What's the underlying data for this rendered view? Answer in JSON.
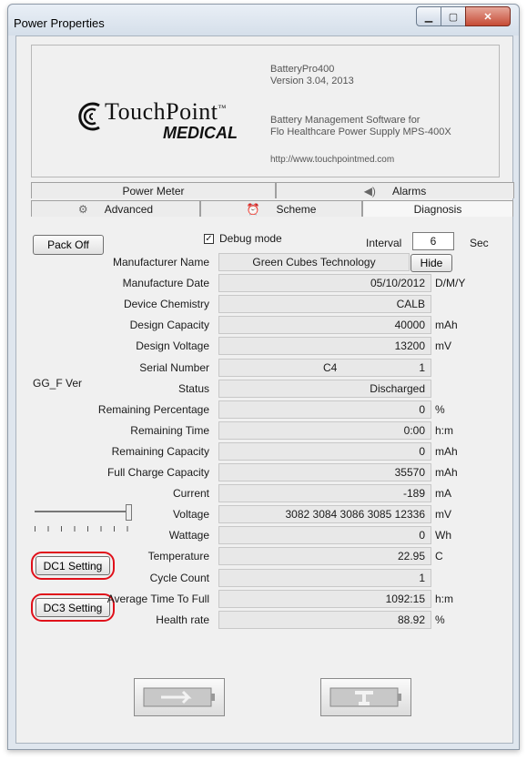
{
  "window": {
    "title": "Power Properties"
  },
  "about": {
    "product": "BatteryPro400",
    "version": "Version  3.04, 2013",
    "desc1": "Battery Management Software for",
    "desc2": "Flo Healthcare Power Supply MPS-400X",
    "url": "http://www.touchpointmed.com",
    "logo_top": "TouchPoint",
    "logo_tm": "™",
    "logo_bottom": "MEDICAL"
  },
  "tabs": {
    "row1": [
      {
        "label": "Power Meter"
      },
      {
        "label": "Alarms"
      }
    ],
    "row2": [
      {
        "label": "Advanced"
      },
      {
        "label": "Scheme"
      },
      {
        "label": "Diagnosis"
      }
    ]
  },
  "controls": {
    "pack_off": "Pack Off",
    "debug_label": "Debug mode",
    "debug_checked": true,
    "interval_label": "Interval",
    "interval_value": "6",
    "interval_unit": "Sec",
    "hide": "Hide",
    "gg_f_ver": "GG_F Ver",
    "dc1": "DC1 Setting",
    "dc3": "DC3 Setting"
  },
  "rows": [
    {
      "label": "Manufacturer Name",
      "value": "Green Cubes Technology",
      "unit": ""
    },
    {
      "label": "Manufacture Date",
      "value": "05/10/2012",
      "unit": "D/M/Y"
    },
    {
      "label": "Device Chemistry",
      "value": "CALB",
      "unit": ""
    },
    {
      "label": "Design Capacity",
      "value": "40000",
      "unit": "mAh"
    },
    {
      "label": "Design Voltage",
      "value": "13200",
      "unit": "mV"
    },
    {
      "label": "Serial Number",
      "value": "1",
      "value2": "C4",
      "unit": ""
    },
    {
      "label": "Status",
      "value": "Discharged",
      "unit": ""
    },
    {
      "label": "Remaining Percentage",
      "value": "0",
      "unit": "%"
    },
    {
      "label": "Remaining Time",
      "value": "0:00",
      "unit": "h:m"
    },
    {
      "label": "Remaining Capacity",
      "value": "0",
      "unit": "mAh"
    },
    {
      "label": "Full Charge Capacity",
      "value": "35570",
      "unit": "mAh"
    },
    {
      "label": "Current",
      "value": "-189",
      "unit": "mA"
    },
    {
      "label": "Voltage",
      "value": "3082 3084 3086 3085  12336",
      "unit": "mV"
    },
    {
      "label": "Wattage",
      "value": "0",
      "unit": "Wh"
    },
    {
      "label": "Temperature",
      "value": "22.95",
      "unit": "C"
    },
    {
      "label": "Cycle Count",
      "value": "1",
      "unit": ""
    },
    {
      "label": "Average Time To Full",
      "value": "1092:15",
      "unit": "h:m"
    },
    {
      "label": "Health rate",
      "value": "88.92",
      "unit": "%"
    }
  ],
  "colors": {
    "highlight_ring": "#e0101a"
  }
}
